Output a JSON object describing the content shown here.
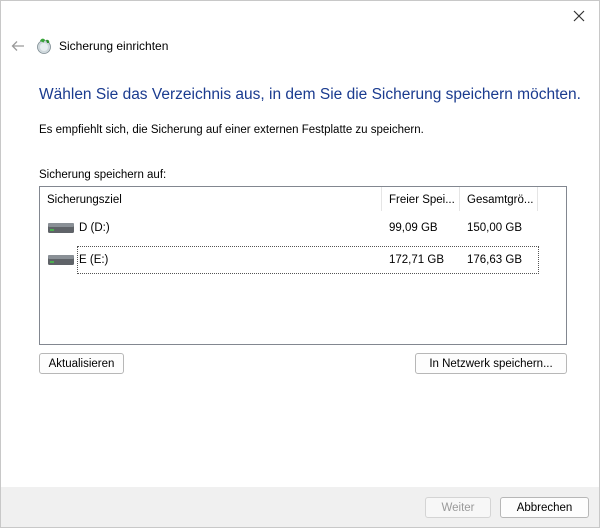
{
  "window": {
    "title": "Sicherung einrichten"
  },
  "heading": "Wählen Sie das Verzeichnis aus, in dem Sie die Sicherung speichern möchten.",
  "subtext": "Es empfiehlt sich, die Sicherung auf einer externen Festplatte zu speichern.",
  "list": {
    "label": "Sicherung speichern auf:",
    "columns": [
      "Sicherungsziel",
      "Freier Spei...",
      "Gesamtgrö..."
    ],
    "rows": [
      {
        "name": "D (D:)",
        "free": "99,09 GB",
        "total": "150,00 GB",
        "icon": "drive-icon"
      },
      {
        "name": "E (E:)",
        "free": "172,71 GB",
        "total": "176,63 GB",
        "icon": "drive-icon"
      }
    ]
  },
  "buttons": {
    "refresh": "Aktualisieren",
    "network": "In Netzwerk speichern...",
    "next": "Weiter",
    "cancel": "Abbrechen"
  },
  "colors": {
    "heading": "#1a3b8f",
    "footer": "#f0f0f0"
  }
}
